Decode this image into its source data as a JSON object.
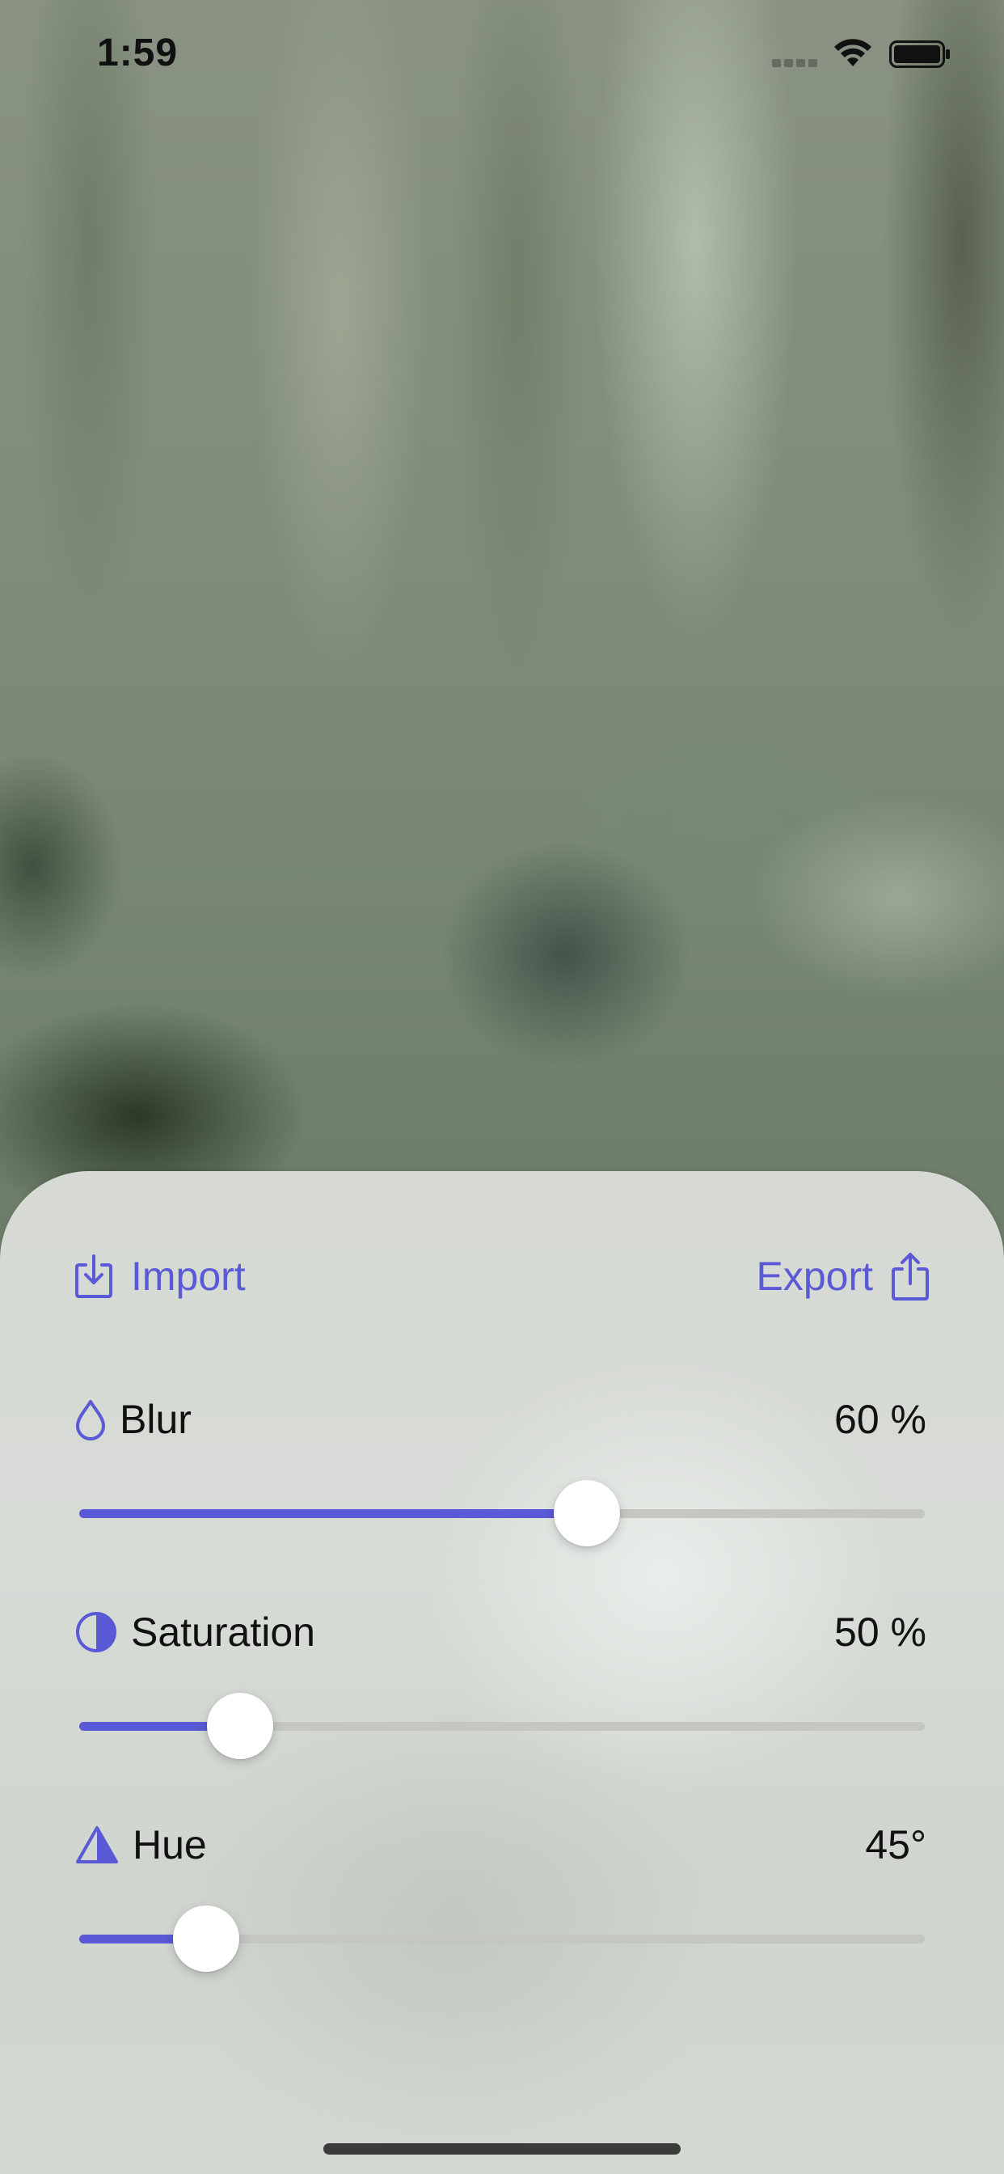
{
  "status_bar": {
    "time": "1:59",
    "icons": [
      "cellular-signal-icon",
      "wifi-icon",
      "battery-icon"
    ]
  },
  "toolbar": {
    "import_label": "Import",
    "import_icon": "square-arrow-down-icon",
    "export_label": "Export",
    "export_icon": "square-arrow-up-icon"
  },
  "controls": [
    {
      "key": "blur",
      "label": "Blur",
      "icon": "drop-icon",
      "value_text": "60 %",
      "slider_fraction": 0.6
    },
    {
      "key": "saturation",
      "label": "Saturation",
      "icon": "circle-half-icon",
      "value_text": "50 %",
      "slider_fraction": 0.19
    },
    {
      "key": "hue",
      "label": "Hue",
      "icon": "triangle-half-icon",
      "value_text": "45°",
      "slider_fraction": 0.15
    }
  ],
  "colors": {
    "accent": "#5a59d6",
    "track": "#c3c6c1",
    "thumb": "#ffffff",
    "text": "#111111"
  }
}
